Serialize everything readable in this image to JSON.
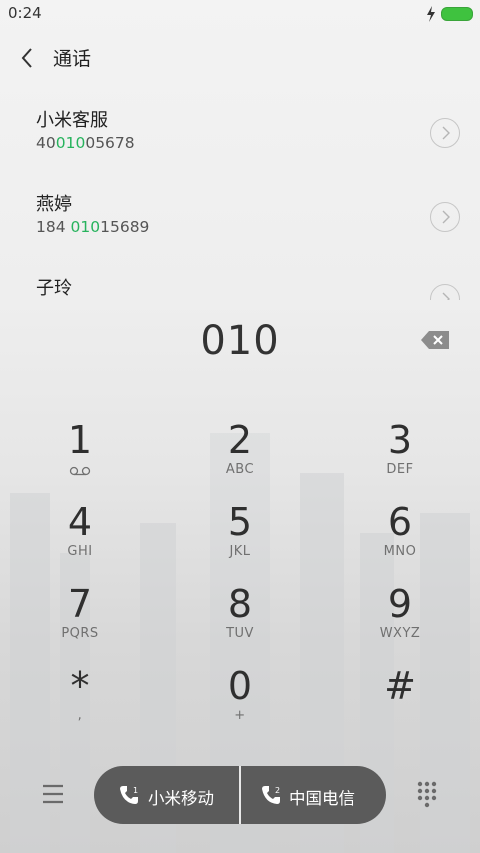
{
  "status": {
    "time": "0:24"
  },
  "header": {
    "title": "通话"
  },
  "contacts": [
    {
      "name": "小米客服",
      "num_pre": "40",
      "num_match": "010",
      "num_post": "05678"
    },
    {
      "name": "燕婷",
      "num_pre": "184 ",
      "num_match": "010",
      "num_post": "15689"
    },
    {
      "name": "子玲"
    }
  ],
  "dialer": {
    "number": "010"
  },
  "keypad": [
    {
      "digit": "1",
      "sub_icon": "voicemail-icon"
    },
    {
      "digit": "2",
      "letters": "ABC"
    },
    {
      "digit": "3",
      "letters": "DEF"
    },
    {
      "digit": "4",
      "letters": "GHI"
    },
    {
      "digit": "5",
      "letters": "JKL"
    },
    {
      "digit": "6",
      "letters": "MNO"
    },
    {
      "digit": "7",
      "letters": "PQRS"
    },
    {
      "digit": "8",
      "letters": "TUV"
    },
    {
      "digit": "9",
      "letters": "WXYZ"
    },
    {
      "digit": "*",
      "letters": ","
    },
    {
      "digit": "0",
      "letters": "+"
    },
    {
      "digit": "#"
    }
  ],
  "sim": [
    {
      "label": "小米移动",
      "slot": "1"
    },
    {
      "label": "中国电信",
      "slot": "2"
    }
  ],
  "colors": {
    "match_highlight": "#27b35d",
    "sim_bar": "#5b5b5b",
    "battery": "#3fc23f"
  },
  "icons": [
    "back-icon",
    "chevron-right-icon",
    "backspace-icon",
    "voicemail-icon",
    "menu-icon",
    "phone-icon",
    "dialpad-icon",
    "charging-bolt-icon",
    "battery-icon"
  ]
}
